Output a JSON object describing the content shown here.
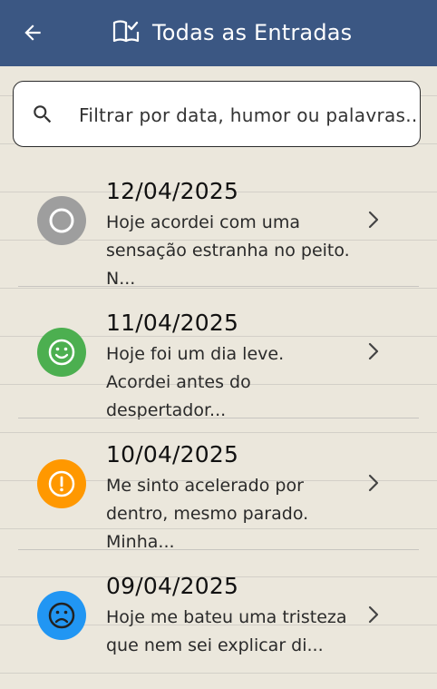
{
  "appbar": {
    "title": "Todas as Entradas",
    "back_icon": "arrow-left-icon",
    "title_icon": "book-check-icon",
    "color": "#3b5783"
  },
  "search": {
    "placeholder": "Filtrar por data, humor ou palavras...",
    "icon": "search-icon"
  },
  "entries": [
    {
      "date": "12/04/2025",
      "preview": "Hoje acordei com uma sensação estranha no peito. N...",
      "mood": "neutral",
      "mood_icon": "circle-outline-icon",
      "mood_color": "#9e9e9e"
    },
    {
      "date": "11/04/2025",
      "preview": "Hoje foi um dia leve. Acordei antes do despertador...",
      "mood": "happy",
      "mood_icon": "smile-icon",
      "mood_color": "#4caf50"
    },
    {
      "date": "10/04/2025",
      "preview": "Me sinto acelerado por dentro, mesmo parado. Minha...",
      "mood": "anxious",
      "mood_icon": "alert-icon",
      "mood_color": "#ff9800"
    },
    {
      "date": "09/04/2025",
      "preview": "Hoje me bateu uma tristeza que nem sei explicar di...",
      "mood": "sad",
      "mood_icon": "frown-icon",
      "mood_color": "#2196f3"
    }
  ]
}
